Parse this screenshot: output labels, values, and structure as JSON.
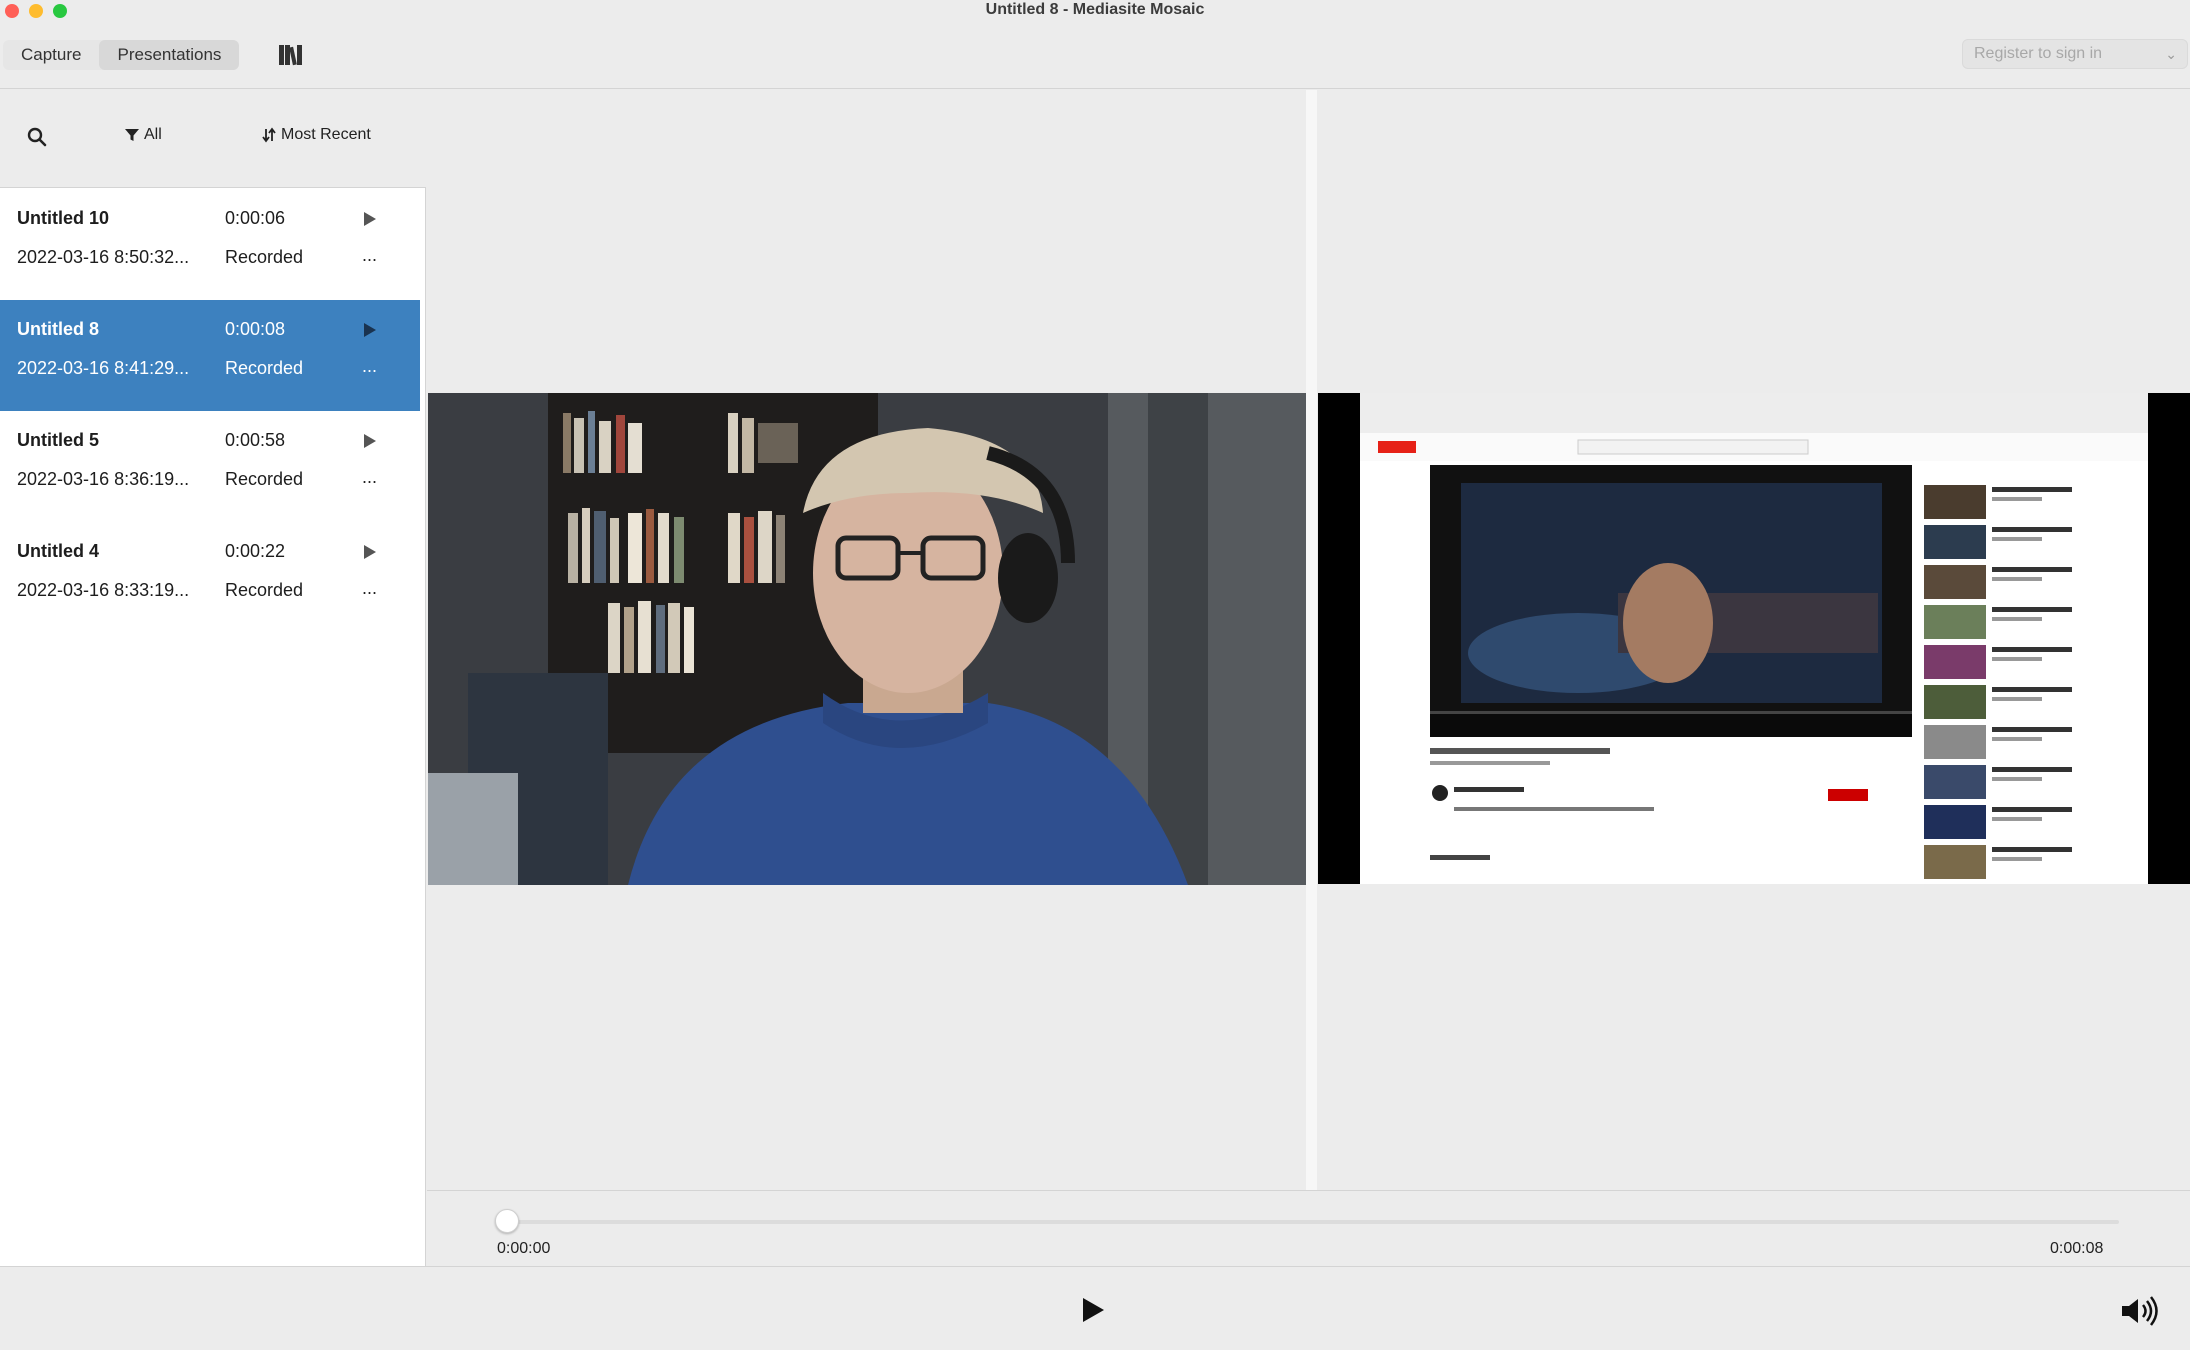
{
  "window": {
    "title": "Untitled 8 - Mediasite Mosaic"
  },
  "toolbar": {
    "tabs": [
      {
        "label": "Capture",
        "active": false
      },
      {
        "label": "Presentations",
        "active": true
      }
    ],
    "library_icon": "library-books-icon",
    "signin_placeholder": "Register to sign in"
  },
  "sidebar": {
    "filter_label": "All",
    "sort_label": "Most Recent",
    "items": [
      {
        "name": "Untitled 10",
        "duration": "0:00:06",
        "date": "2022-03-16 8:50:32...",
        "status": "Recorded",
        "more": "...",
        "selected": false
      },
      {
        "name": "Untitled 8",
        "duration": "0:00:08",
        "date": "2022-03-16 8:41:29...",
        "status": "Recorded",
        "more": "...",
        "selected": true
      },
      {
        "name": "Untitled 5",
        "duration": "0:00:58",
        "date": "2022-03-16 8:36:19...",
        "status": "Recorded",
        "more": "...",
        "selected": false
      },
      {
        "name": "Untitled 4",
        "duration": "0:00:22",
        "date": "2022-03-16 8:33:19...",
        "status": "Recorded",
        "more": "...",
        "selected": false
      }
    ]
  },
  "playback": {
    "current_time": "0:00:00",
    "total_time": "0:00:08",
    "progress": 0
  },
  "colors": {
    "selection": "#3d81bf",
    "window_bg": "#ececec"
  }
}
